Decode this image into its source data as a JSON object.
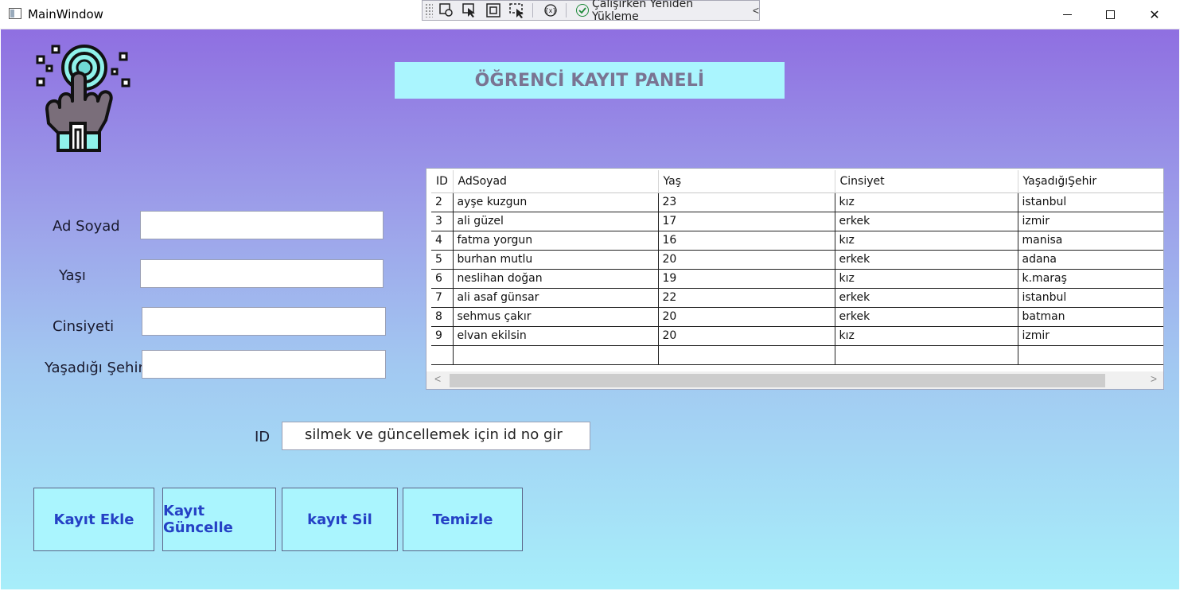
{
  "window": {
    "title": "MainWindow",
    "minimize_icon": "minimize-icon",
    "maximize_icon": "maximize-icon",
    "close_icon": "close-icon",
    "close_glyph": "✕"
  },
  "debug_toolbar": {
    "hot_reload_label": "Çalışırken Yeniden Yükleme",
    "collapse_glyph": "<"
  },
  "header": {
    "title": "ÖĞRENCİ KAYIT PANELİ"
  },
  "form": {
    "name_label": "Ad Soyad",
    "age_label": "Yaşı",
    "gender_label": "Cinsiyeti",
    "city_label": "Yaşadığı Şehir",
    "name_value": "",
    "age_value": "",
    "gender_value": "",
    "city_value": ""
  },
  "id_input": {
    "label": "ID",
    "value": "silmek ve güncellemek için id no gir"
  },
  "grid": {
    "columns": [
      "ID",
      "AdSoyad",
      "Yaş",
      "Cinsiyet",
      "YaşadığıŞehir"
    ],
    "rows": [
      [
        "2",
        "ayşe kuzgun",
        "23",
        "kız",
        "istanbul"
      ],
      [
        "3",
        "ali güzel",
        "17",
        "erkek",
        "izmir"
      ],
      [
        "4",
        "fatma yorgun",
        "16",
        "kız",
        "manisa"
      ],
      [
        "5",
        "burhan mutlu",
        "20",
        "erkek",
        "adana"
      ],
      [
        "6",
        "neslihan doğan",
        "19",
        "kız",
        "k.maraş"
      ],
      [
        "7",
        "ali asaf günsar",
        "22",
        "erkek",
        "istanbul"
      ],
      [
        "8",
        "sehmus çakır",
        "20",
        "erkek",
        "batman"
      ],
      [
        "9",
        "elvan ekilsin",
        "20",
        "kız",
        "izmir"
      ]
    ],
    "scroll_left_glyph": "<",
    "scroll_right_glyph": ">"
  },
  "buttons": {
    "add": "Kayıt Ekle",
    "update": "Kayıt Güncelle",
    "delete": "kayıt Sil",
    "clear": "Temizle"
  },
  "colors": {
    "gradient_top": "#8f6fe1",
    "gradient_bottom": "#a7eefa",
    "button_bg": "#aaf5fe",
    "button_text": "#2541c5",
    "title_text": "#7a7492"
  }
}
